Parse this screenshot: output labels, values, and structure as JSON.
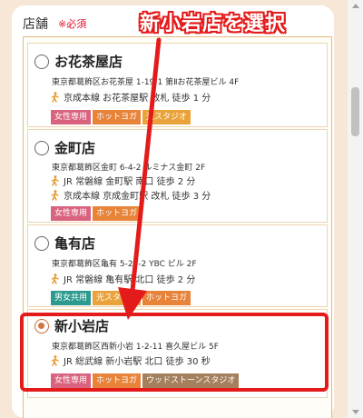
{
  "form": {
    "label": "店舗",
    "required": "※必須"
  },
  "annotation": {
    "callout": "新小岩店を選択",
    "color": "#e41b1b"
  },
  "stores": [
    {
      "name": "お花茶屋店",
      "address": "東京都葛飾区お花茶屋 1-19-1 第Ⅱお花茶屋ビル 4F",
      "access": [
        "京成本線 お花茶屋駅 改札 徒歩 1 分"
      ],
      "tags": [
        "女性専用",
        "ホットヨガ",
        "光スタジオ"
      ],
      "selected": false
    },
    {
      "name": "金町店",
      "address": "東京都葛飾区金町 6-4-2 ルミナス金町 2F",
      "access": [
        "JR 常磐線 金町駅 南口 徒歩 2 分",
        "京成本線 京成金町駅 改札 徒歩 3 分"
      ],
      "tags": [
        "女性専用",
        "ホットヨガ"
      ],
      "selected": false
    },
    {
      "name": "亀有店",
      "address": "東京都葛飾区亀有 5-28-2 YBC ビル 2F",
      "access": [
        "JR 常磐線 亀有駅 北口 徒歩 2 分"
      ],
      "tags": [
        "男女共用",
        "光スタジオ",
        "ホットヨガ"
      ],
      "selected": false
    },
    {
      "name": "新小岩店",
      "address": "東京都葛飾区西新小岩 1-2-11 喜久屋ビル 5F",
      "access": [
        "JR 総武線 新小岩駅 北口 徒歩 30 秒"
      ],
      "tags": [
        "女性専用",
        "ホットヨガ",
        "ウッドストーンスタジオ"
      ],
      "selected": true
    }
  ],
  "tag_colors": {
    "女性専用": "#d9637f",
    "ホットヨガ": "#e8833a",
    "光スタジオ": "#eaa23a",
    "男女共用": "#2e9a8f",
    "ウッドストーンスタジオ": "#a5805d"
  }
}
